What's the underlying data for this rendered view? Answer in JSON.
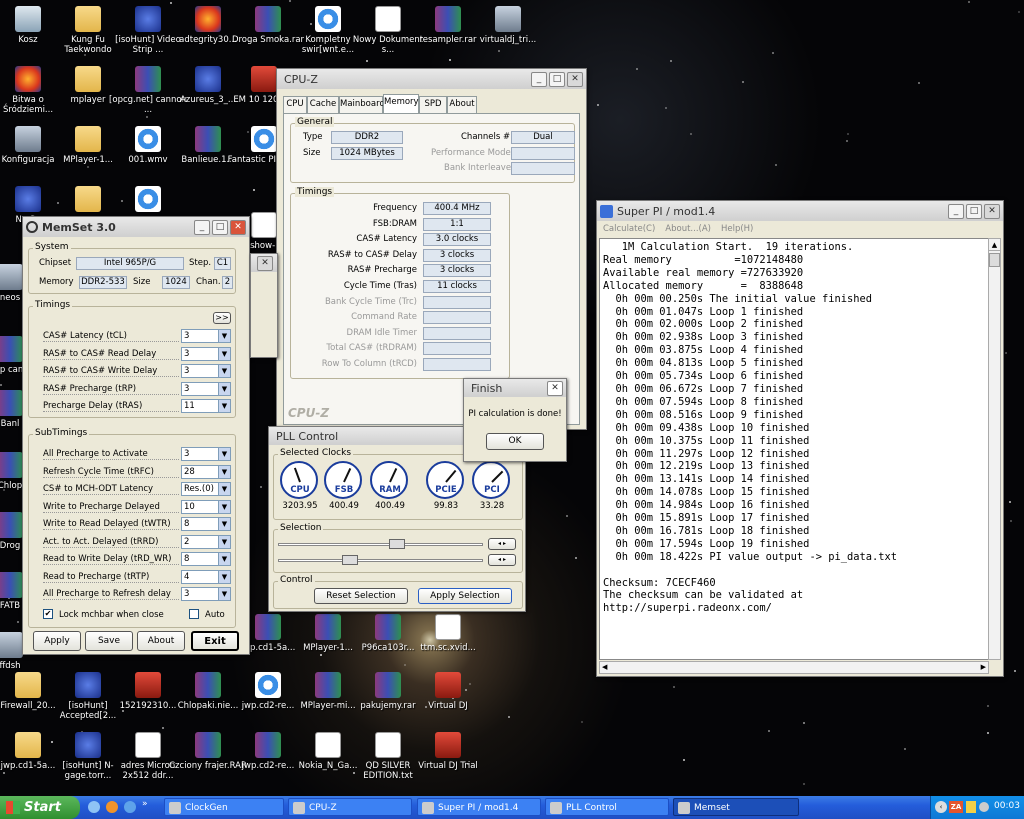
{
  "desktop_icons": [
    {
      "label": "Kosz",
      "glyph": "g-bin"
    },
    {
      "label": "Kung Fu Taekwondo",
      "glyph": "g-folder"
    },
    {
      "label": "[isoHunt] Video Strip ...",
      "glyph": "g-blue"
    },
    {
      "label": "adtegrity30...",
      "glyph": "g-fire"
    },
    {
      "label": "Droga Smoka.rar",
      "glyph": "g-rar"
    },
    {
      "label": "Kompletny swir[wnt.e...",
      "glyph": "g-media"
    },
    {
      "label": "Nowy Dokument s...",
      "glyph": "g-doc"
    },
    {
      "label": "resampler.rar",
      "glyph": "g-rar"
    },
    {
      "label": "virtualdj_tri...",
      "glyph": "g-cfg"
    },
    {
      "label": "Bitwa o Śródziemi...",
      "glyph": "g-fire"
    },
    {
      "label": "mplayer",
      "glyph": "g-folder"
    },
    {
      "label": "[opcg.net] cannon ...",
      "glyph": "g-rar"
    },
    {
      "label": "Azureus_3_...",
      "glyph": "g-blue"
    },
    {
      "label": "EM 10 120.1...",
      "glyph": "g-red"
    },
    {
      "label": "Konfiguracja",
      "glyph": "g-cfg"
    },
    {
      "label": "MPlayer-1...",
      "glyph": "g-folder"
    },
    {
      "label": "001.wmv",
      "glyph": "g-media"
    },
    {
      "label": "Banlieue.1...",
      "glyph": "g-rar"
    },
    {
      "label": "Fantastic PI 2005",
      "glyph": "g-media"
    },
    {
      "label": "Ne Sp",
      "glyph": "g-blue"
    },
    {
      "label": "",
      "glyph": "g-folder"
    },
    {
      "label": "",
      "glyph": "g-media"
    },
    {
      "label": "dshow-...",
      "glyph": "g-doc"
    },
    {
      "label": "neos",
      "glyph": "g-cfg"
    },
    {
      "label": "[op cann",
      "glyph": "g-rar"
    },
    {
      "label": "Banl",
      "glyph": "g-rar"
    },
    {
      "label": "Chlop",
      "glyph": "g-rar"
    },
    {
      "label": "Drog",
      "glyph": "g-rar"
    },
    {
      "label": "FATB",
      "glyph": "g-rar"
    },
    {
      "label": "ffdsh",
      "glyph": "g-cfg"
    },
    {
      "label": "jwp.cd1-5a...",
      "glyph": "g-rar"
    },
    {
      "label": "MPlayer-1...",
      "glyph": "g-rar"
    },
    {
      "label": "P96ca103r...",
      "glyph": "g-rar"
    },
    {
      "label": "ttm.sc.xvid...",
      "glyph": "g-doc"
    },
    {
      "label": "Firewall_20...",
      "glyph": "g-folder"
    },
    {
      "label": "[isoHunt] Accepted[2...",
      "glyph": "g-blue"
    },
    {
      "label": "152192310...",
      "glyph": "g-red"
    },
    {
      "label": "Chlopaki.nie...",
      "glyph": "g-rar"
    },
    {
      "label": "jwp.cd2-re...",
      "glyph": "g-media"
    },
    {
      "label": "MPlayer-mi...",
      "glyph": "g-rar"
    },
    {
      "label": "pakujemy.rar",
      "glyph": "g-rar"
    },
    {
      "label": "Virtual DJ",
      "glyph": "g-red"
    },
    {
      "label": "jwp.cd1-5a...",
      "glyph": "g-folder"
    },
    {
      "label": "[isoHunt] N-gage.torr...",
      "glyph": "g-blue"
    },
    {
      "label": "adres Micron 2x512 ddr...",
      "glyph": "g-doc"
    },
    {
      "label": "Czciony frajer.RAR",
      "glyph": "g-rar"
    },
    {
      "label": "jwp.cd2-re...",
      "glyph": "g-rar"
    },
    {
      "label": "Nokia_N_Ga...",
      "glyph": "g-doc"
    },
    {
      "label": "QD SILVER EDITION.txt",
      "glyph": "g-doc"
    },
    {
      "label": "Virtual DJ Trial",
      "glyph": "g-red"
    }
  ],
  "cpuz": {
    "title": "CPU-Z",
    "tabs": [
      "CPU",
      "Cache",
      "Mainboard",
      "Memory",
      "SPD",
      "About"
    ],
    "active_tab": "Memory",
    "general": {
      "legend": "General",
      "type_label": "Type",
      "type": "DDR2",
      "size_label": "Size",
      "size": "1024 MBytes",
      "channels_label": "Channels #",
      "channels": "Dual",
      "perf_label": "Performance Mode",
      "interleave_label": "Bank Interleave"
    },
    "timings": {
      "legend": "Timings",
      "rows": [
        [
          "Frequency",
          "400.4 MHz"
        ],
        [
          "FSB:DRAM",
          "1:1"
        ],
        [
          "CAS# Latency",
          "3.0 clocks"
        ],
        [
          "RAS# to CAS# Delay",
          "3 clocks"
        ],
        [
          "RAS# Precharge",
          "3 clocks"
        ],
        [
          "Cycle Time (Tras)",
          "11 clocks"
        ],
        [
          "Bank Cycle Time (Trc)",
          ""
        ],
        [
          "Command Rate",
          ""
        ],
        [
          "DRAM Idle Timer",
          ""
        ],
        [
          "Total CAS# (tRDRAM)",
          ""
        ],
        [
          "Row To Column (tRCD)",
          ""
        ]
      ]
    },
    "footer": "CPU-Z"
  },
  "pll": {
    "title": "PLL Control",
    "clocks_legend": "Selected Clocks",
    "dials": [
      {
        "name": "CPU",
        "value": "3203.95"
      },
      {
        "name": "FSB",
        "value": "400.49"
      },
      {
        "name": "RAM",
        "value": "400.49"
      },
      {
        "name": "PCIE",
        "value": "99.83"
      },
      {
        "name": "PCI",
        "value": "33.28"
      }
    ],
    "selection_legend": "Selection",
    "control_legend": "Control",
    "reset": "Reset Selection",
    "apply": "Apply Selection"
  },
  "finish": {
    "title": "Finish",
    "message": "PI calculation is done!",
    "ok": "OK"
  },
  "memset": {
    "title": "MemSet 3.0",
    "system": {
      "legend": "System",
      "chipset_label": "Chipset",
      "chipset": "Intel 965P/G",
      "step_label": "Step.",
      "step": "C1",
      "memory_label": "Memory",
      "memory": "DDR2-533",
      "size_label": "Size",
      "size": "1024",
      "chan_label": "Chan.",
      "chan": "2"
    },
    "timings": {
      "legend": "Timings",
      "more": ">>",
      "rows": [
        [
          "CAS# Latency (tCL)",
          "3"
        ],
        [
          "RAS# to CAS# Read Delay",
          "3"
        ],
        [
          "RAS# to CAS# Write Delay",
          "3"
        ],
        [
          "RAS# Precharge (tRP)",
          "3"
        ],
        [
          "Precharge Delay  (tRAS)",
          "11"
        ]
      ]
    },
    "subtimings": {
      "legend": "SubTimings",
      "rows": [
        [
          "All Precharge to Activate",
          "3"
        ],
        [
          "Refresh Cycle Time (tRFC)",
          "28"
        ],
        [
          "CS# to MCH-ODT Latency",
          "Res.(0)"
        ],
        [
          "Write to Precharge Delayed",
          "10"
        ],
        [
          "Write to Read Delayed (tWTR)",
          "8"
        ],
        [
          "Act. to Act. Delayed (tRRD)",
          "2"
        ],
        [
          "Read to Write Delay (tRD_WR)",
          "8"
        ],
        [
          "Read to Precharge (tRTP)",
          "4"
        ],
        [
          "All Precharge to Refresh delay",
          "3"
        ]
      ]
    },
    "lock": "Lock mchbar when close",
    "auto": "Auto",
    "apply": "Apply",
    "save": "Save",
    "about": "About",
    "exit": "Exit"
  },
  "superpi": {
    "title": "Super PI / mod1.4",
    "menu": [
      "Calculate(C)",
      "About...(A)",
      "Help(H)"
    ],
    "lines": [
      "   1M Calculation Start.  19 iterations.",
      "Real memory          =1072148480",
      "Available real memory =727633920",
      "Allocated memory      =  8388648",
      "  0h 00m 00.250s The initial value finished",
      "  0h 00m 01.047s Loop 1 finished",
      "  0h 00m 02.000s Loop 2 finished",
      "  0h 00m 02.938s Loop 3 finished",
      "  0h 00m 03.875s Loop 4 finished",
      "  0h 00m 04.813s Loop 5 finished",
      "  0h 00m 05.734s Loop 6 finished",
      "  0h 00m 06.672s Loop 7 finished",
      "  0h 00m 07.594s Loop 8 finished",
      "  0h 00m 08.516s Loop 9 finished",
      "  0h 00m 09.438s Loop 10 finished",
      "  0h 00m 10.375s Loop 11 finished",
      "  0h 00m 11.297s Loop 12 finished",
      "  0h 00m 12.219s Loop 13 finished",
      "  0h 00m 13.141s Loop 14 finished",
      "  0h 00m 14.078s Loop 15 finished",
      "  0h 00m 14.984s Loop 16 finished",
      "  0h 00m 15.891s Loop 17 finished",
      "  0h 00m 16.781s Loop 18 finished",
      "  0h 00m 17.594s Loop 19 finished",
      "  0h 00m 18.422s PI value output -> pi_data.txt",
      "",
      "Checksum: 7CECF460",
      "The checksum can be validated at",
      "http://superpi.radeonx.com/"
    ]
  },
  "taskbar": {
    "start": "Start",
    "tasks": [
      "ClockGen",
      "CPU-Z",
      "Super PI / mod1.4",
      "PLL Control",
      "Memset"
    ],
    "active": "Memset",
    "clock": "00:03",
    "tray": "ZA"
  }
}
